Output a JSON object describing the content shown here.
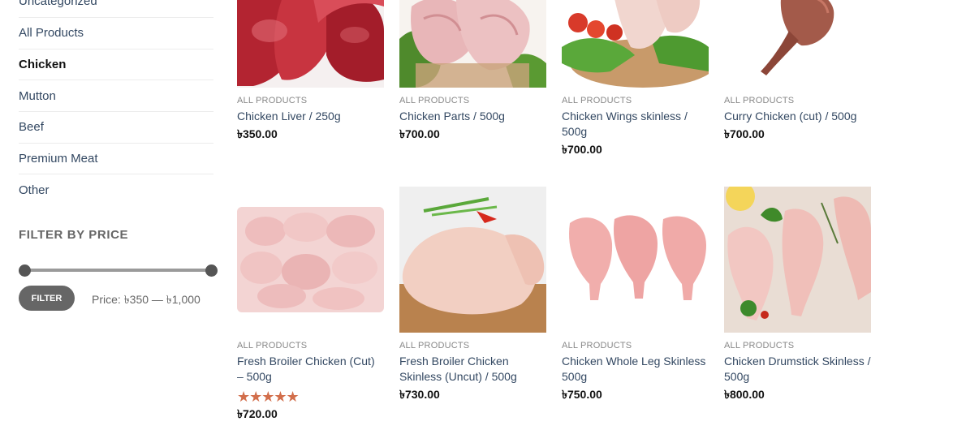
{
  "sidebar": {
    "categories": [
      {
        "label": "Uncategorized"
      },
      {
        "label": "All Products"
      },
      {
        "label": "Chicken"
      },
      {
        "label": "Mutton"
      },
      {
        "label": "Beef"
      },
      {
        "label": "Premium Meat"
      },
      {
        "label": "Other"
      }
    ],
    "filter": {
      "title": "FILTER BY PRICE",
      "button_label": "FILTER",
      "price_prefix": "Price:",
      "price_range": "৳350 — ৳1,000"
    }
  },
  "products": [
    {
      "category": "ALL PRODUCTS",
      "name": "Chicken Liver / 250g",
      "price": "৳350.00"
    },
    {
      "category": "ALL PRODUCTS",
      "name": "Chicken Parts / 500g",
      "price": "৳700.00"
    },
    {
      "category": "ALL PRODUCTS",
      "name": "Chicken Wings skinless / 500g",
      "price": "৳700.00"
    },
    {
      "category": "ALL PRODUCTS",
      "name": "Curry Chicken (cut) / 500g",
      "price": "৳700.00"
    },
    {
      "category": "ALL PRODUCTS",
      "name": "Fresh Broiler Chicken (Cut) – 500g",
      "price": "৳720.00",
      "rating": 5,
      "stars": "★★★★★"
    },
    {
      "category": "ALL PRODUCTS",
      "name": "Fresh Broiler Chicken Skinless (Uncut) / 500g",
      "price": "৳730.00"
    },
    {
      "category": "ALL PRODUCTS",
      "name": "Chicken Whole Leg Skinless 500g",
      "price": "৳750.00"
    },
    {
      "category": "ALL PRODUCTS",
      "name": "Chicken Drumstick Skinless / 500g",
      "price": "৳800.00"
    }
  ],
  "colors": {
    "link": "#334862",
    "star": "#d26e4b",
    "button": "#666666"
  }
}
